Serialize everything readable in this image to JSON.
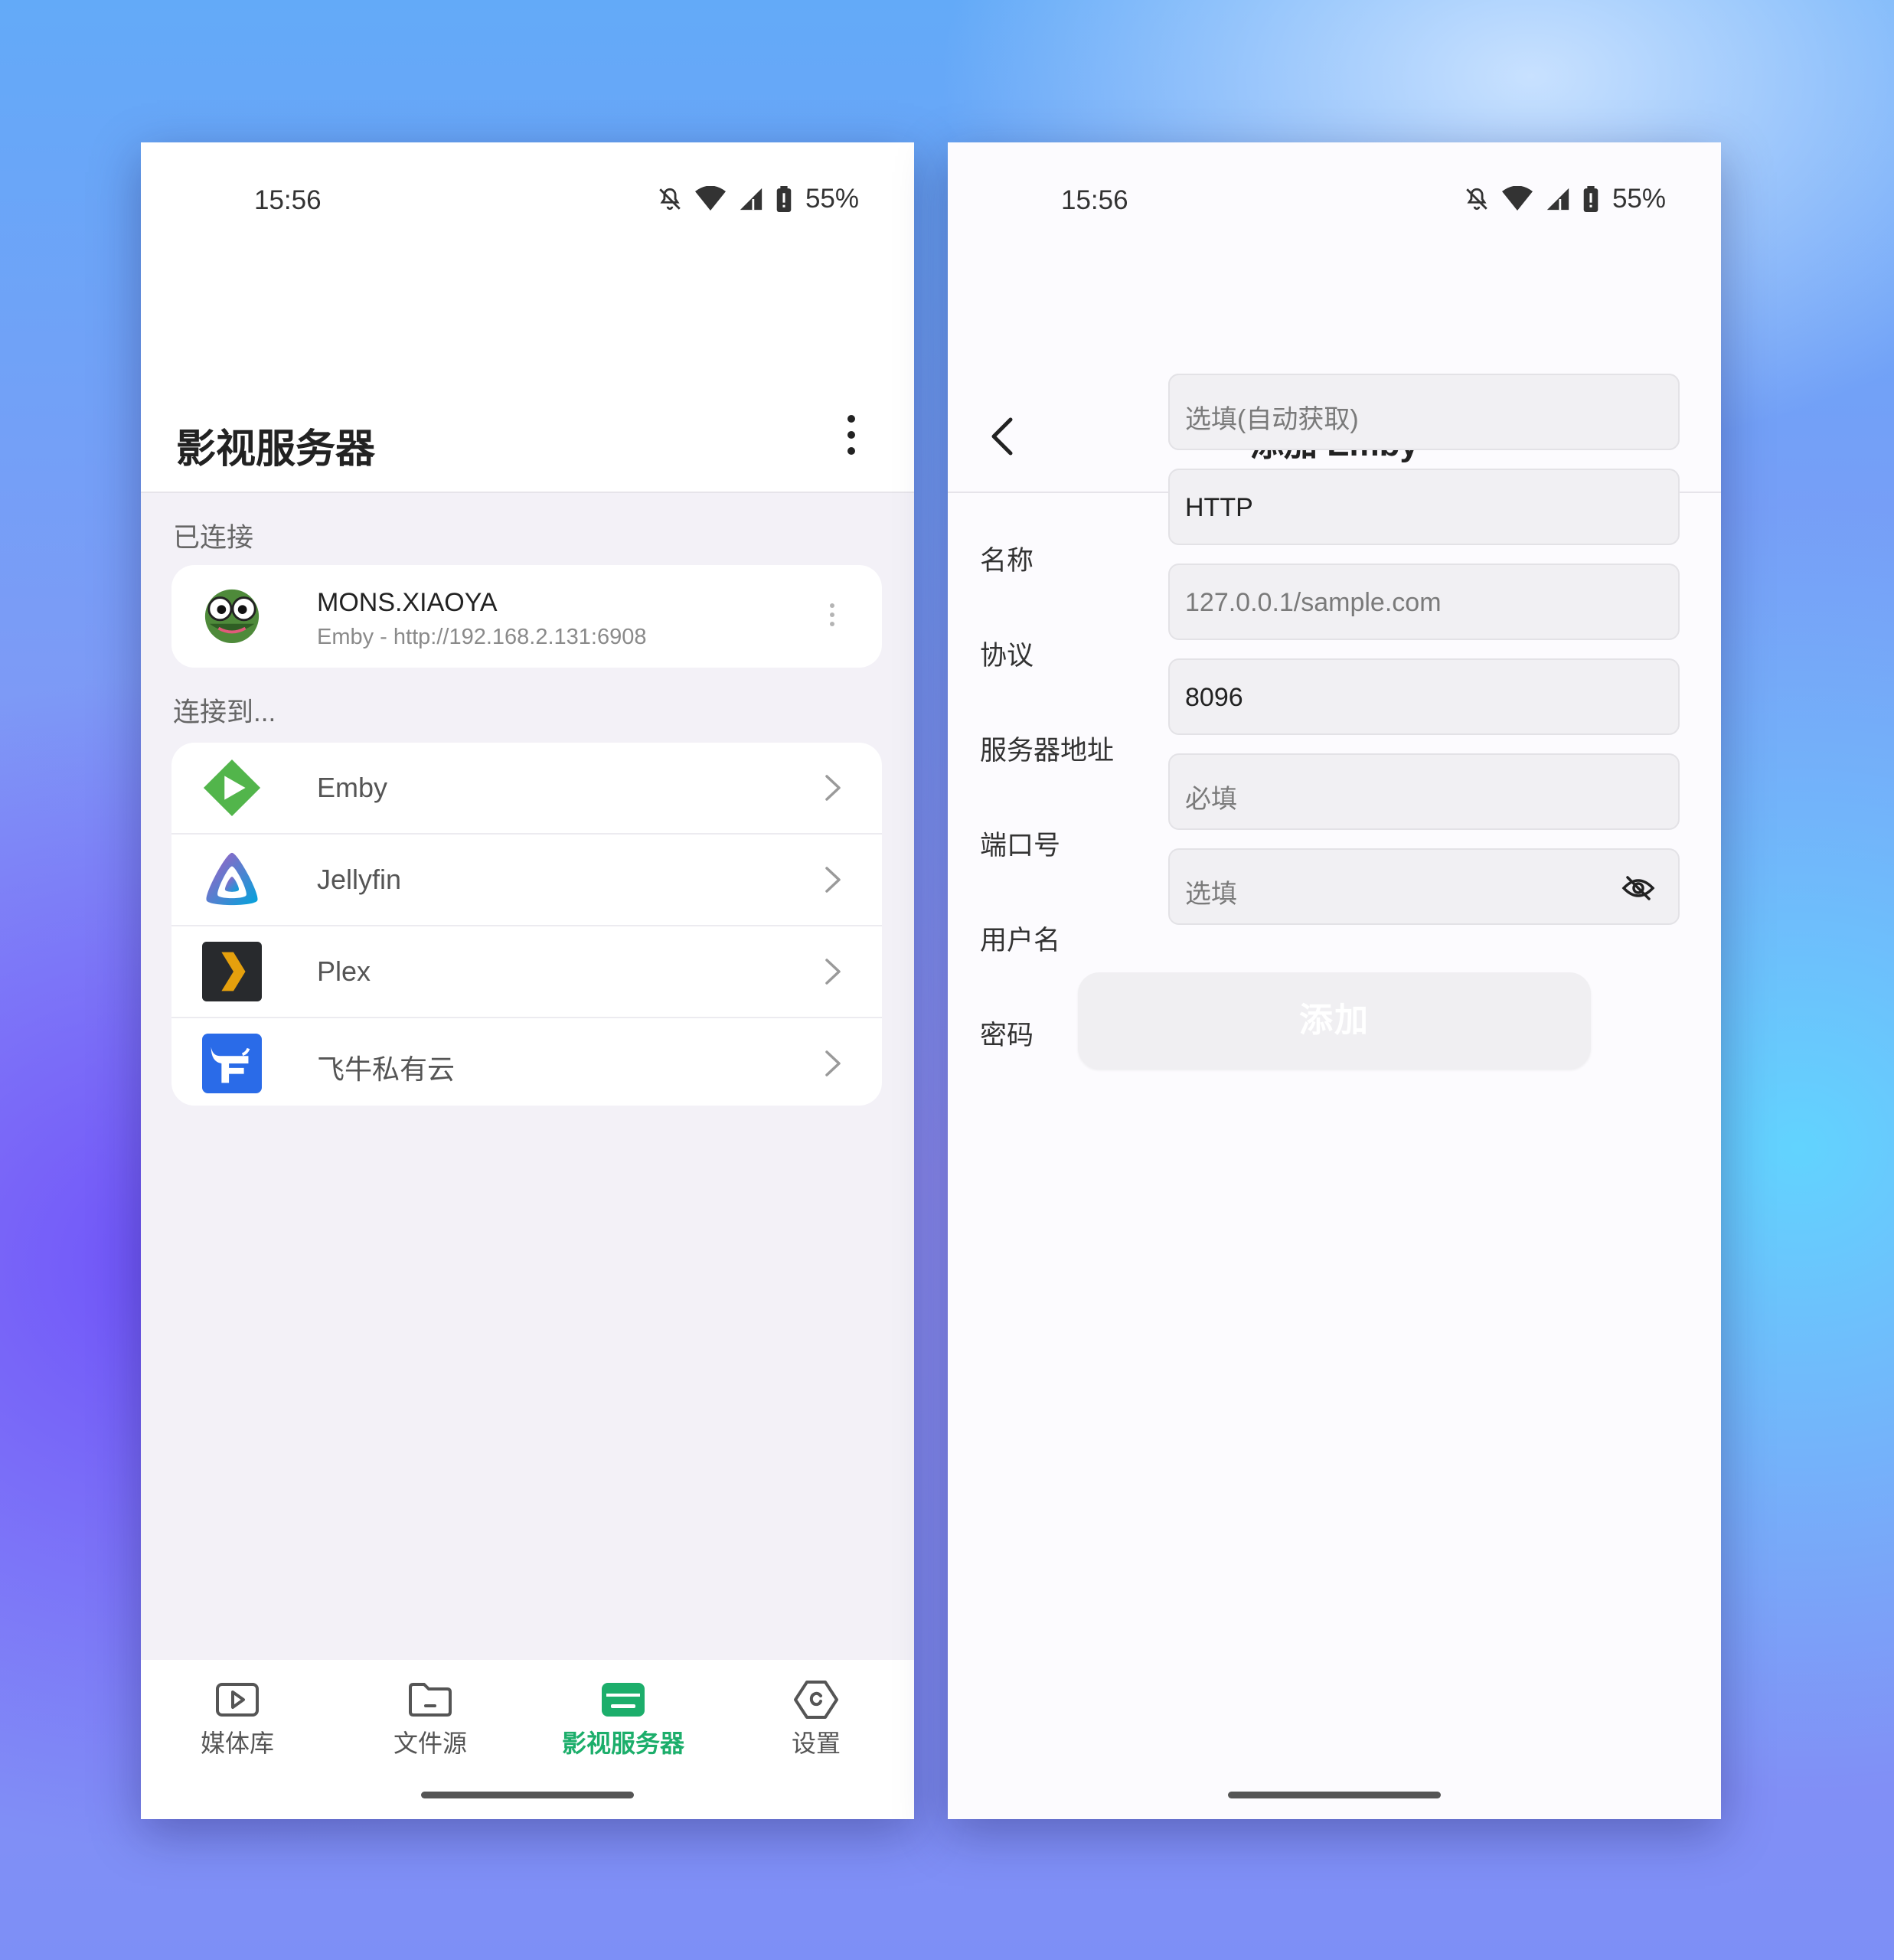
{
  "left_screen": {
    "status": {
      "time": "15:56",
      "battery": "55%"
    },
    "title": "影视服务器",
    "connected_section": "已连接",
    "connected_server": {
      "name": "MONS.XIAOYA",
      "subtitle": "Emby - http://192.168.2.131:6908"
    },
    "connect_section": "连接到...",
    "services": [
      {
        "label": "Emby",
        "icon": "emby-icon"
      },
      {
        "label": "Jellyfin",
        "icon": "jellyfin-icon"
      },
      {
        "label": "Plex",
        "icon": "plex-icon"
      },
      {
        "label": "飞牛私有云",
        "icon": "feiniu-icon"
      }
    ],
    "nav": [
      {
        "label": "媒体库",
        "icon": "media-library-icon",
        "active": false
      },
      {
        "label": "文件源",
        "icon": "folder-icon",
        "active": false
      },
      {
        "label": "影视服务器",
        "icon": "server-icon",
        "active": true
      },
      {
        "label": "设置",
        "icon": "settings-icon",
        "active": false
      }
    ]
  },
  "right_screen": {
    "status": {
      "time": "15:56",
      "battery": "55%"
    },
    "title": "添加 Emby",
    "form": {
      "name": {
        "label": "名称",
        "placeholder": "选填(自动获取)"
      },
      "protocol": {
        "label": "协议",
        "value": "HTTP"
      },
      "address": {
        "label": "服务器地址",
        "placeholder": "127.0.0.1/sample.com"
      },
      "port": {
        "label": "端口号",
        "value": "8096"
      },
      "username": {
        "label": "用户名",
        "placeholder": "必填"
      },
      "password": {
        "label": "密码",
        "placeholder": "选填"
      }
    },
    "submit_label": "添加"
  },
  "colors": {
    "accent": "#1cae6b",
    "emby_green": "#52b54b",
    "plex_orange": "#e5a00d",
    "feiniu_blue": "#2a6be8"
  }
}
